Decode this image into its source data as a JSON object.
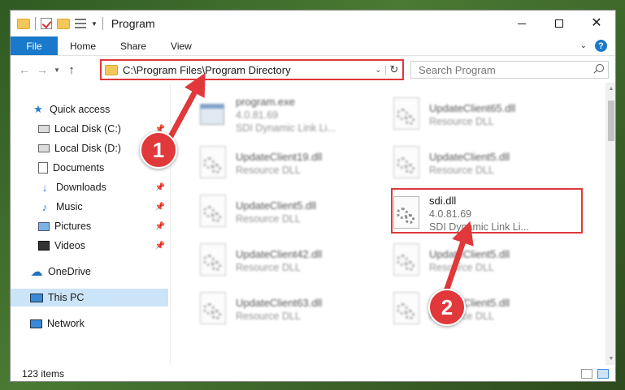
{
  "window": {
    "title": "Program",
    "controls": {
      "minimize": "minimize",
      "maximize": "maximize",
      "close": "✕"
    }
  },
  "ribbon": {
    "tabs": [
      "File",
      "Home",
      "Share",
      "View"
    ]
  },
  "navigation": {
    "address": "C:\\Program Files\\Program Directory",
    "search_placeholder": "Search Program"
  },
  "sidebar": {
    "items": [
      {
        "label": "Quick access",
        "icon": "star-icon",
        "pinned": false
      },
      {
        "label": "Local Disk (C:)",
        "icon": "disk-icon",
        "pinned": true
      },
      {
        "label": "Local Disk (D:)",
        "icon": "disk-icon",
        "pinned": false
      },
      {
        "label": "Documents",
        "icon": "document-icon",
        "pinned": false
      },
      {
        "label": "Downloads",
        "icon": "download-icon",
        "pinned": true
      },
      {
        "label": "Music",
        "icon": "music-icon",
        "pinned": true
      },
      {
        "label": "Pictures",
        "icon": "picture-icon",
        "pinned": true
      },
      {
        "label": "Videos",
        "icon": "video-icon",
        "pinned": true
      },
      {
        "label": "OneDrive",
        "icon": "cloud-icon",
        "pinned": false
      },
      {
        "label": "This PC",
        "icon": "computer-icon",
        "pinned": false,
        "selected": true
      },
      {
        "label": "Network",
        "icon": "network-icon",
        "pinned": false
      }
    ]
  },
  "files": [
    {
      "name": "program.exe",
      "line2": "4.0.81.69",
      "line3": "SDI Dynamic Link Li...",
      "type": "exe",
      "blurred": true
    },
    {
      "name": "UpdateClient65.dll",
      "line2": "Resource DLL",
      "type": "dll",
      "blurred": true
    },
    {
      "name": "UpdateClient19.dll",
      "line2": "Resource DLL",
      "type": "dll",
      "blurred": true
    },
    {
      "name": "UpdateClient5.dll",
      "line2": "Resource DLL",
      "type": "dll",
      "blurred": true
    },
    {
      "name": "UpdateClient5.dll",
      "line2": "Resource DLL",
      "type": "dll",
      "blurred": true
    },
    {
      "name": "sdi.dll",
      "line2": "4.0.81.69",
      "line3": "SDI Dynamic Link Li...",
      "type": "dll",
      "blurred": false,
      "highlighted": true
    },
    {
      "name": "UpdateClient42.dll",
      "line2": "Resource DLL",
      "type": "dll",
      "blurred": true
    },
    {
      "name": "UpdateClient5.dll",
      "line2": "Resource DLL",
      "type": "dll",
      "blurred": true
    },
    {
      "name": "UpdateClient63.dll",
      "line2": "Resource DLL",
      "type": "dll",
      "blurred": true
    },
    {
      "name": "UpdateClient5.dll",
      "line2": "Resource DLL",
      "type": "dll",
      "blurred": true
    }
  ],
  "status": {
    "item_count": "123 items"
  },
  "annotations": {
    "badge1": "1",
    "badge2": "2",
    "color": "#e0383b"
  }
}
